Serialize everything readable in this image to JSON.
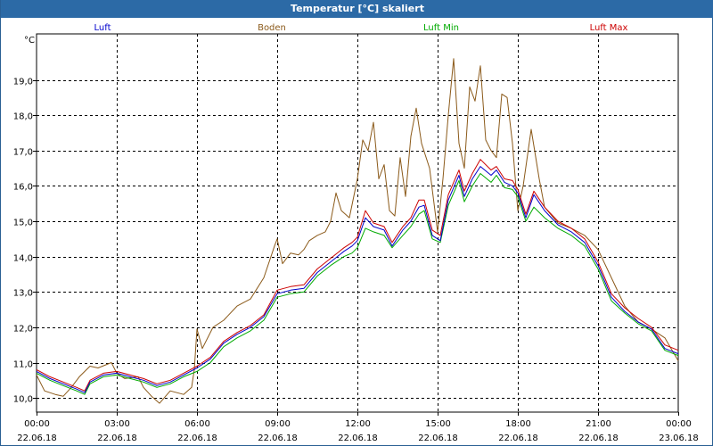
{
  "window": {
    "title": "Temperatur [°C] skaliert"
  },
  "chart_data": {
    "type": "line",
    "title": "Temperatur [°C] skaliert",
    "ylabel": "°C",
    "xlabel": "",
    "ylim": [
      9.6,
      20.3
    ],
    "yticks": [
      10.0,
      11.0,
      12.0,
      13.0,
      14.0,
      15.0,
      16.0,
      17.0,
      18.0,
      19.0
    ],
    "ytick_labels": [
      "10,0",
      "11,0",
      "12,0",
      "13,0",
      "14,0",
      "15,0",
      "16,0",
      "17,0",
      "18,0",
      "19,0"
    ],
    "xticks": [
      0,
      3,
      6,
      9,
      12,
      15,
      18,
      21,
      24
    ],
    "xtick_labels": [
      [
        "00:00",
        "22.06.18"
      ],
      [
        "03:00",
        "22.06.18"
      ],
      [
        "06:00",
        "22.06.18"
      ],
      [
        "09:00",
        "22.06.18"
      ],
      [
        "12:00",
        "22.06.18"
      ],
      [
        "15:00",
        "22.06.18"
      ],
      [
        "18:00",
        "22.06.18"
      ],
      [
        "21:00",
        "22.06.18"
      ],
      [
        "00:00",
        "23.06.18"
      ]
    ],
    "grid": true,
    "legend_placement": "top",
    "series": [
      {
        "name": "Luft",
        "color": "#0000cc",
        "x": [
          0,
          0.5,
          1,
          1.5,
          1.8,
          2,
          2.5,
          3,
          3.5,
          4,
          4.5,
          5,
          5.5,
          6,
          6.5,
          7,
          7.5,
          8,
          8.5,
          9,
          9.5,
          10,
          10.5,
          11,
          11.5,
          11.8,
          12,
          12.3,
          12.6,
          13,
          13.3,
          13.7,
          14,
          14.3,
          14.5,
          14.8,
          15.1,
          15.4,
          15.8,
          16,
          16.3,
          16.6,
          17,
          17.2,
          17.5,
          17.8,
          18,
          18.3,
          18.6,
          19,
          19.5,
          20,
          20.5,
          21,
          21.5,
          22,
          22.5,
          23,
          23.5,
          24
        ],
        "y": [
          10.75,
          10.55,
          10.4,
          10.25,
          10.15,
          10.45,
          10.65,
          10.7,
          10.6,
          10.5,
          10.35,
          10.45,
          10.65,
          10.85,
          11.1,
          11.55,
          11.8,
          12.0,
          12.3,
          12.95,
          13.05,
          13.1,
          13.55,
          13.85,
          14.15,
          14.3,
          14.45,
          15.1,
          14.85,
          14.75,
          14.3,
          14.75,
          15.0,
          15.4,
          15.45,
          14.6,
          14.45,
          15.6,
          16.3,
          15.7,
          16.2,
          16.55,
          16.3,
          16.45,
          16.1,
          16.0,
          15.8,
          15.1,
          15.75,
          15.3,
          14.9,
          14.7,
          14.4,
          13.75,
          12.85,
          12.45,
          12.15,
          11.95,
          11.4,
          11.25
        ]
      },
      {
        "name": "Boden",
        "color": "#8b5a1a",
        "x": [
          0,
          0.3,
          0.7,
          1,
          1.3,
          1.6,
          2,
          2.3,
          2.8,
          3,
          3.3,
          3.8,
          4,
          4.3,
          4.6,
          5,
          5.5,
          5.8,
          5.9,
          6,
          6.2,
          6.6,
          7,
          7.5,
          8,
          8.5,
          8.9,
          9,
          9.2,
          9.5,
          9.8,
          10,
          10.2,
          10.5,
          10.8,
          11,
          11.2,
          11.4,
          11.7,
          12,
          12.2,
          12.4,
          12.6,
          12.8,
          13,
          13.2,
          13.4,
          13.6,
          13.8,
          14,
          14.2,
          14.4,
          14.7,
          15,
          15.2,
          15.4,
          15.6,
          15.8,
          16,
          16.2,
          16.4,
          16.6,
          16.8,
          17,
          17.2,
          17.4,
          17.6,
          17.8,
          18,
          18.2,
          18.5,
          18.8,
          19,
          19.5,
          20,
          20.5,
          21,
          21.5,
          22,
          22.5,
          23,
          23.5,
          24
        ],
        "y": [
          10.65,
          10.2,
          10.1,
          10.05,
          10.3,
          10.6,
          10.9,
          10.85,
          11.0,
          10.7,
          10.55,
          10.6,
          10.3,
          10.05,
          9.85,
          10.2,
          10.1,
          10.3,
          10.8,
          11.95,
          11.4,
          12.0,
          12.2,
          12.6,
          12.8,
          13.4,
          14.3,
          14.5,
          13.8,
          14.1,
          14.05,
          14.2,
          14.45,
          14.6,
          14.7,
          15.0,
          15.8,
          15.3,
          15.1,
          16.2,
          17.3,
          17.0,
          17.8,
          16.2,
          16.6,
          15.3,
          15.15,
          16.8,
          15.7,
          17.4,
          18.2,
          17.2,
          16.5,
          14.7,
          16.2,
          18.0,
          19.6,
          17.2,
          16.5,
          18.8,
          18.4,
          19.4,
          17.3,
          17.0,
          16.8,
          18.6,
          18.5,
          17.2,
          15.3,
          16.0,
          17.6,
          16.2,
          15.4,
          14.95,
          14.8,
          14.6,
          14.2,
          13.4,
          12.6,
          12.15,
          11.95,
          11.7,
          11.05
        ]
      },
      {
        "name": "Luft Min",
        "color": "#00aa00",
        "x": [
          0,
          0.5,
          1,
          1.5,
          1.8,
          2,
          2.5,
          3,
          3.5,
          4,
          4.5,
          5,
          5.5,
          6,
          6.5,
          7,
          7.5,
          8,
          8.5,
          9,
          9.5,
          10,
          10.5,
          11,
          11.5,
          11.8,
          12,
          12.3,
          12.6,
          13,
          13.3,
          13.7,
          14,
          14.3,
          14.5,
          14.8,
          15.1,
          15.4,
          15.8,
          16,
          16.3,
          16.6,
          17,
          17.2,
          17.5,
          17.8,
          18,
          18.3,
          18.6,
          19,
          19.5,
          20,
          20.5,
          21,
          21.5,
          22,
          22.5,
          23,
          23.5,
          24
        ],
        "y": [
          10.7,
          10.5,
          10.35,
          10.2,
          10.1,
          10.4,
          10.6,
          10.65,
          10.55,
          10.45,
          10.3,
          10.4,
          10.6,
          10.75,
          11.0,
          11.45,
          11.7,
          11.9,
          12.2,
          12.85,
          12.95,
          13.0,
          13.45,
          13.75,
          14.0,
          14.1,
          14.25,
          14.8,
          14.7,
          14.6,
          14.25,
          14.6,
          14.85,
          15.2,
          15.3,
          14.5,
          14.4,
          15.45,
          16.15,
          15.55,
          16.0,
          16.35,
          16.1,
          16.3,
          15.95,
          15.9,
          15.7,
          15.0,
          15.4,
          15.1,
          14.8,
          14.6,
          14.3,
          13.65,
          12.75,
          12.4,
          12.1,
          11.9,
          11.35,
          11.2
        ]
      },
      {
        "name": "Luft Max",
        "color": "#cc0000",
        "x": [
          0,
          0.5,
          1,
          1.5,
          1.8,
          2,
          2.5,
          3,
          3.5,
          4,
          4.5,
          5,
          5.5,
          6,
          6.5,
          7,
          7.5,
          8,
          8.5,
          9,
          9.5,
          10,
          10.5,
          11,
          11.5,
          11.8,
          12,
          12.3,
          12.6,
          13,
          13.3,
          13.7,
          14,
          14.3,
          14.5,
          14.8,
          15.1,
          15.4,
          15.8,
          16,
          16.3,
          16.6,
          17,
          17.2,
          17.5,
          17.8,
          18,
          18.3,
          18.6,
          19,
          19.5,
          20,
          20.5,
          21,
          21.5,
          22,
          22.5,
          23,
          23.5,
          24
        ],
        "y": [
          10.8,
          10.6,
          10.45,
          10.3,
          10.2,
          10.5,
          10.7,
          10.75,
          10.65,
          10.55,
          10.4,
          10.5,
          10.7,
          10.9,
          11.15,
          11.6,
          11.85,
          12.05,
          12.35,
          13.05,
          13.15,
          13.2,
          13.65,
          13.95,
          14.25,
          14.4,
          14.55,
          15.3,
          14.95,
          14.85,
          14.4,
          14.85,
          15.1,
          15.6,
          15.6,
          14.75,
          14.6,
          15.75,
          16.45,
          15.85,
          16.35,
          16.75,
          16.45,
          16.55,
          16.2,
          16.15,
          15.9,
          15.2,
          15.85,
          15.4,
          15.0,
          14.8,
          14.5,
          13.85,
          12.95,
          12.55,
          12.25,
          12.0,
          11.5,
          11.35
        ]
      }
    ]
  }
}
